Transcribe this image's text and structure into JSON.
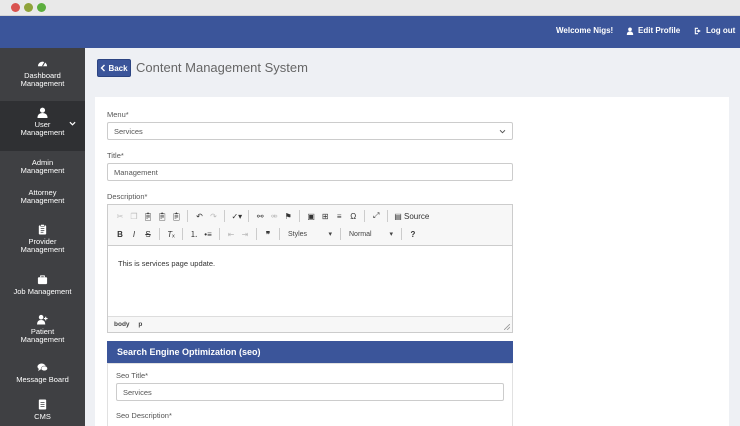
{
  "topbar": {
    "welcome": "Welcome Nigs!",
    "edit_profile": "Edit Profile",
    "logout": "Log out"
  },
  "sidebar": {
    "items": [
      {
        "label1": "Dashboard",
        "label2": "Management",
        "icon": "dashboard-icon"
      },
      {
        "label1": "User",
        "label2": "Management",
        "icon": "user-icon"
      },
      {
        "label1": "Provider",
        "label2": "Management",
        "icon": "clipboard-icon"
      },
      {
        "label1": "Job Management",
        "label2": "",
        "icon": "briefcase-icon"
      },
      {
        "label1": "Patient",
        "label2": "Management",
        "icon": "add-user-icon"
      },
      {
        "label1": "Message Board",
        "label2": "",
        "icon": "comments-icon"
      },
      {
        "label1": "CMS",
        "label2": "",
        "icon": "document-icon"
      }
    ],
    "subitems": [
      {
        "label1": "Admin",
        "label2": "Management"
      },
      {
        "label1": "Attorney",
        "label2": "Management"
      }
    ]
  },
  "header": {
    "back_label": "Back",
    "title": "Content Management System"
  },
  "form": {
    "menu_label": "Menu*",
    "menu_value": "Services",
    "title_label": "Title*",
    "title_value": "Management",
    "description_label": "Description*"
  },
  "editor": {
    "source_label": "Source",
    "styles_label": "Styles",
    "format_label": "Normal",
    "help_label": "?",
    "body_text": "This is services page update.",
    "path": [
      "body",
      "p"
    ]
  },
  "seo": {
    "heading": "Search Engine Optimization (seo)",
    "title_label": "Seo Title*",
    "title_value": "Services",
    "description_label": "Seo Description*"
  }
}
